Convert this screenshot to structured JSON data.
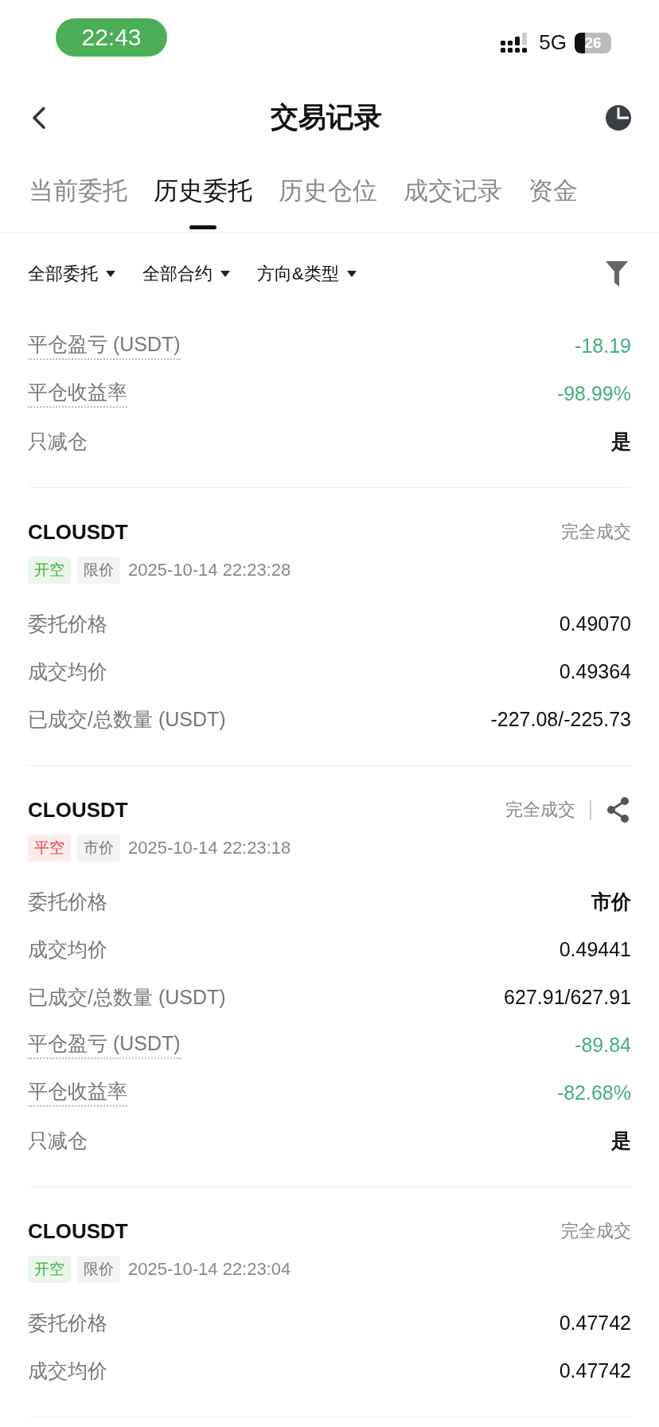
{
  "status_bar": {
    "time": "22:43",
    "network": "5G",
    "battery": "26"
  },
  "header": {
    "title": "交易记录"
  },
  "tabs": [
    {
      "label": "当前委托",
      "selected": false
    },
    {
      "label": "历史委托",
      "selected": true
    },
    {
      "label": "历史仓位",
      "selected": false
    },
    {
      "label": "成交记录",
      "selected": false
    },
    {
      "label": "资金",
      "selected": false
    }
  ],
  "filters": [
    "全部委托",
    "全部合约",
    "方向&类型"
  ],
  "partial_record": {
    "rows": [
      {
        "label": "平仓盈亏 (USDT)",
        "value": "-18.19",
        "dotted": true,
        "kind": "negative"
      },
      {
        "label": "平仓收益率",
        "value": "-98.99%",
        "dotted": true,
        "kind": "negative"
      },
      {
        "label": "只减仓",
        "value": "是",
        "dotted": false,
        "kind": "strong"
      }
    ]
  },
  "records": [
    {
      "symbol": "CLOUSDT",
      "status": "完全成交",
      "share": false,
      "tags": [
        {
          "label": "开空",
          "kind": "open"
        },
        {
          "label": "限价",
          "kind": "type"
        }
      ],
      "time": "2025-10-14 22:23:28",
      "rows": [
        {
          "label": "委托价格",
          "value": "0.49070",
          "dotted": false,
          "kind": "normal"
        },
        {
          "label": "成交均价",
          "value": "0.49364",
          "dotted": false,
          "kind": "normal"
        },
        {
          "label": "已成交/总数量 (USDT)",
          "value": "-227.08/-225.73",
          "dotted": false,
          "kind": "normal"
        }
      ]
    },
    {
      "symbol": "CLOUSDT",
      "status": "完全成交",
      "share": true,
      "tags": [
        {
          "label": "平空",
          "kind": "close"
        },
        {
          "label": "市价",
          "kind": "type"
        }
      ],
      "time": "2025-10-14 22:23:18",
      "rows": [
        {
          "label": "委托价格",
          "value": "市价",
          "dotted": false,
          "kind": "strong"
        },
        {
          "label": "成交均价",
          "value": "0.49441",
          "dotted": false,
          "kind": "normal"
        },
        {
          "label": "已成交/总数量 (USDT)",
          "value": "627.91/627.91",
          "dotted": false,
          "kind": "normal"
        },
        {
          "label": "平仓盈亏 (USDT)",
          "value": "-89.84",
          "dotted": true,
          "kind": "negative"
        },
        {
          "label": "平仓收益率",
          "value": "-82.68%",
          "dotted": true,
          "kind": "negative"
        },
        {
          "label": "只减仓",
          "value": "是",
          "dotted": false,
          "kind": "strong"
        }
      ]
    },
    {
      "symbol": "CLOUSDT",
      "status": "完全成交",
      "share": false,
      "tags": [
        {
          "label": "开空",
          "kind": "open"
        },
        {
          "label": "限价",
          "kind": "type"
        }
      ],
      "time": "2025-10-14 22:23:04",
      "rows": [
        {
          "label": "委托价格",
          "value": "0.47742",
          "dotted": false,
          "kind": "normal"
        },
        {
          "label": "成交均价",
          "value": "0.47742",
          "dotted": false,
          "kind": "normal"
        }
      ]
    }
  ]
}
